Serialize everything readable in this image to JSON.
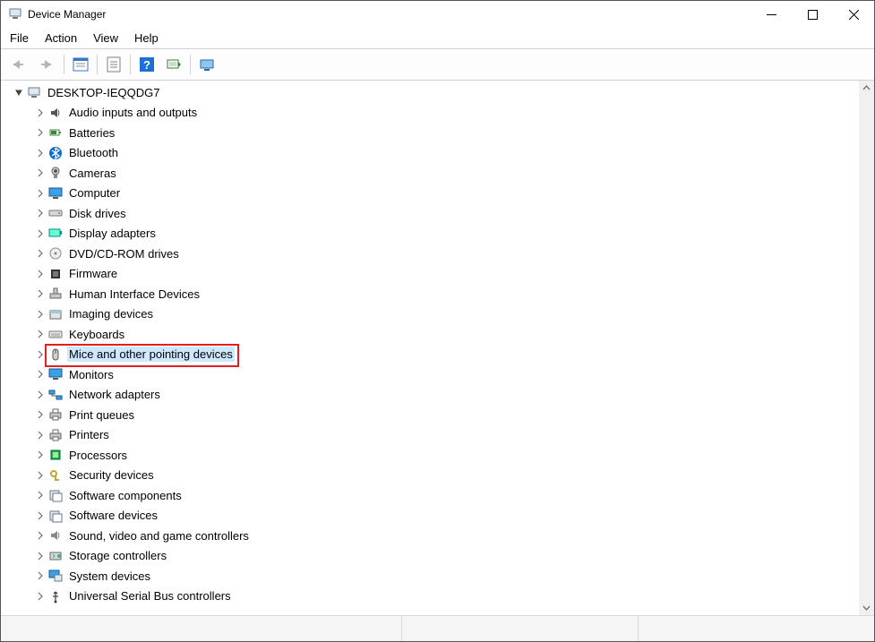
{
  "window": {
    "title": "Device Manager"
  },
  "menu": {
    "file": "File",
    "action": "Action",
    "view": "View",
    "help": "Help"
  },
  "tree": {
    "root": {
      "label": "DESKTOP-IEQQDG7",
      "icon": "computer-icon"
    }
  },
  "categories": [
    {
      "label": "Audio inputs and outputs",
      "icon": "speaker-icon"
    },
    {
      "label": "Batteries",
      "icon": "battery-icon"
    },
    {
      "label": "Bluetooth",
      "icon": "bluetooth-icon"
    },
    {
      "label": "Cameras",
      "icon": "camera-icon"
    },
    {
      "label": "Computer",
      "icon": "monitor-icon"
    },
    {
      "label": "Disk drives",
      "icon": "disk-icon"
    },
    {
      "label": "Display adapters",
      "icon": "display-adapter-icon"
    },
    {
      "label": "DVD/CD-ROM drives",
      "icon": "dvd-icon"
    },
    {
      "label": "Firmware",
      "icon": "chip-icon"
    },
    {
      "label": "Human Interface Devices",
      "icon": "hid-icon"
    },
    {
      "label": "Imaging devices",
      "icon": "imaging-icon"
    },
    {
      "label": "Keyboards",
      "icon": "keyboard-icon"
    },
    {
      "label": "Mice and other pointing devices",
      "icon": "mouse-icon",
      "highlight": true
    },
    {
      "label": "Monitors",
      "icon": "monitor-icon"
    },
    {
      "label": "Network adapters",
      "icon": "network-icon"
    },
    {
      "label": "Print queues",
      "icon": "printer-icon"
    },
    {
      "label": "Printers",
      "icon": "printer-icon"
    },
    {
      "label": "Processors",
      "icon": "cpu-icon"
    },
    {
      "label": "Security devices",
      "icon": "security-icon"
    },
    {
      "label": "Software components",
      "icon": "software-icon"
    },
    {
      "label": "Software devices",
      "icon": "software-icon"
    },
    {
      "label": "Sound, video and game controllers",
      "icon": "sound-icon"
    },
    {
      "label": "Storage controllers",
      "icon": "storage-icon"
    },
    {
      "label": "System devices",
      "icon": "system-icon"
    },
    {
      "label": "Universal Serial Bus controllers",
      "icon": "usb-icon"
    }
  ]
}
